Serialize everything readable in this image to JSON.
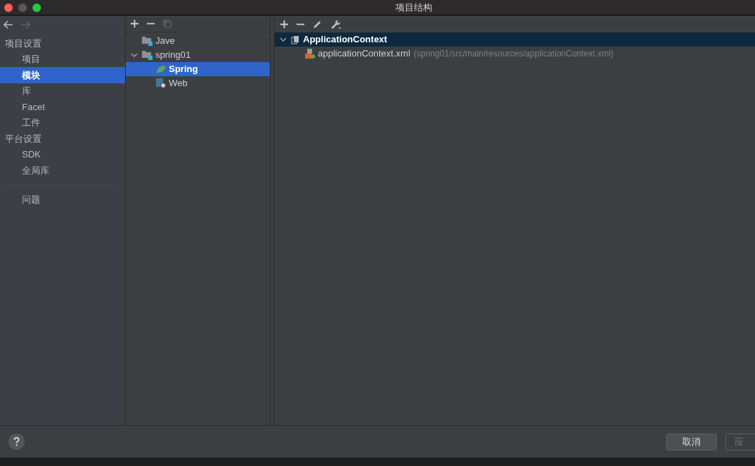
{
  "window": {
    "title": "项目结构"
  },
  "sidebar": {
    "items": [
      {
        "kind": "header",
        "label": "项目设置",
        "selected": false
      },
      {
        "kind": "item",
        "label": "项目",
        "selected": false
      },
      {
        "kind": "item",
        "label": "模块",
        "selected": true
      },
      {
        "kind": "item",
        "label": "库",
        "selected": false
      },
      {
        "kind": "item",
        "label": "Facet",
        "selected": false
      },
      {
        "kind": "item",
        "label": "工件",
        "selected": false
      },
      {
        "kind": "header",
        "label": "平台设置",
        "selected": false
      },
      {
        "kind": "item",
        "label": "SDK",
        "selected": false
      },
      {
        "kind": "item",
        "label": "全局库",
        "selected": false
      },
      {
        "kind": "separator"
      },
      {
        "kind": "item",
        "label": "问题",
        "selected": false
      }
    ]
  },
  "modules": {
    "tree": [
      {
        "kind": "module",
        "label": "Jave",
        "selected": false
      },
      {
        "kind": "module",
        "label": "spring01",
        "selected": false,
        "expanded": true,
        "children": [
          {
            "kind": "spring",
            "label": "Spring",
            "selected": true
          },
          {
            "kind": "web",
            "label": "Web",
            "selected": false
          }
        ]
      }
    ]
  },
  "facet": {
    "tree": [
      {
        "kind": "context",
        "label": "ApplicationContext",
        "selected": true,
        "expanded": true,
        "children": [
          {
            "kind": "xml",
            "label": "applicationContext.xml",
            "path": "(spring01/src/main/resources/applicationContext.xml)",
            "selected": false
          }
        ]
      }
    ]
  },
  "buttons": [
    {
      "label": "取消",
      "disabled": false
    },
    {
      "label": "应",
      "disabled": true
    }
  ]
}
